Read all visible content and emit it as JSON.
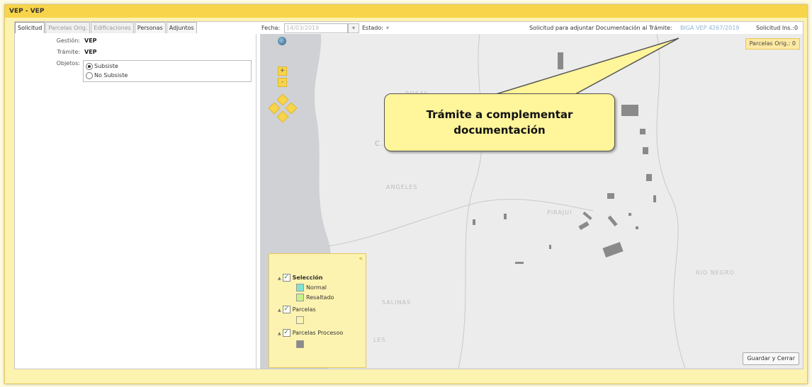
{
  "window": {
    "title": "VEP - VEP"
  },
  "tabs": [
    {
      "label": "Solicitud",
      "state": "active"
    },
    {
      "label": "Parcelas Orig.",
      "state": "disabled"
    },
    {
      "label": "Edificaciones",
      "state": "disabled"
    },
    {
      "label": "Personas",
      "state": "normal"
    },
    {
      "label": "Adjuntos",
      "state": "normal"
    }
  ],
  "form": {
    "gestion_label": "Gestión:",
    "gestion_value": "VEP",
    "tramite_label": "Trámite:",
    "tramite_value": "VEP",
    "objetos_label": "Objetos:",
    "radio_options": [
      {
        "label": "Subsiste",
        "checked": true
      },
      {
        "label": "No Subsiste",
        "checked": false
      }
    ]
  },
  "toolbar": {
    "fecha_label": "Fecha:",
    "fecha_value": "14/03/2019",
    "estado_label": "Estado:",
    "estado_value": "",
    "info_text": "Solicitud para adjuntar Documentación al Trámite:",
    "tramite_link": "BIGA VEP 4267/2019",
    "solicitud_label": "Solicitud Ins.:",
    "solicitud_value": "0"
  },
  "map": {
    "parcelas_button": "Parcelas Orig.: 0",
    "zoom_in": "+",
    "zoom_out": "-",
    "legend": {
      "close_label": "«",
      "items": [
        {
          "label": "Selección",
          "type": "group",
          "checked": true,
          "bold": true
        },
        {
          "label": "Normal",
          "type": "swatch",
          "color": "#7fe3d0"
        },
        {
          "label": "Resaltado",
          "type": "swatch",
          "color": "#c7f08a"
        },
        {
          "label": "Parcelas",
          "type": "group",
          "checked": true,
          "bold": false
        },
        {
          "label": "",
          "type": "swatch",
          "color": "#fdf3b0"
        },
        {
          "label": "Parcelas Procesoo",
          "type": "group",
          "checked": true,
          "bold": false
        },
        {
          "label": "",
          "type": "swatch",
          "color": "#8a8a8a"
        }
      ]
    },
    "place_labels": [
      "ROSAS",
      "C. N",
      "ANGELES",
      "PIRAJUI",
      "RIO NEGRO",
      "SALINAS",
      "LES"
    ]
  },
  "callout": {
    "line1": "Trámite a complementar",
    "line2": "documentación"
  },
  "footer": {
    "save_button": "Guardar y Cerrar"
  },
  "colors": {
    "accent": "#f7d44a",
    "window_bg": "#fdf3b0",
    "callout_bg": "#fff59a",
    "map_bg": "#ececec",
    "water": "#cfd1d4"
  }
}
